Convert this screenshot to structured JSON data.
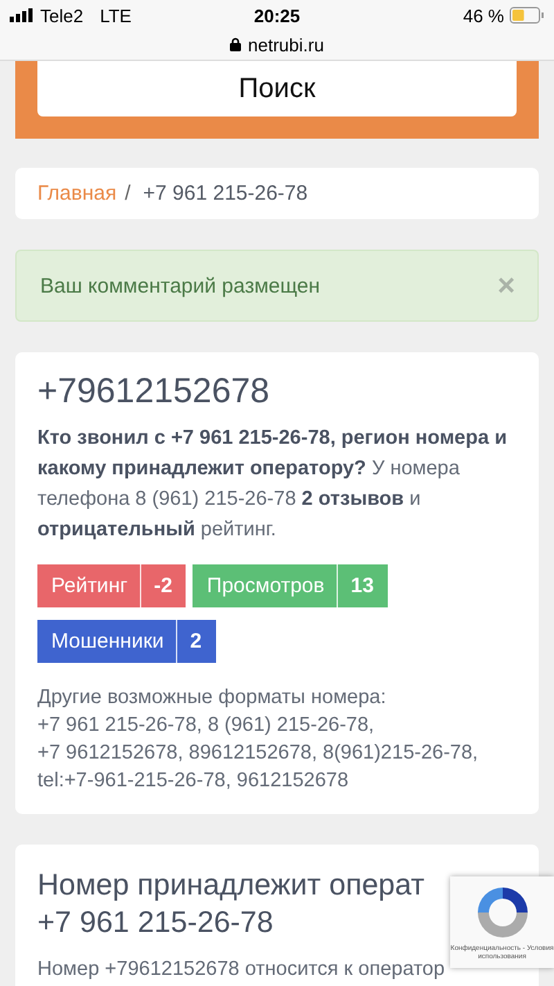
{
  "status_bar": {
    "carrier": "Tele2",
    "network": "LTE",
    "time": "20:25",
    "battery": "46 %"
  },
  "address_bar": {
    "url": "netrubi.ru"
  },
  "search_button": {
    "label": "Поиск"
  },
  "breadcrumb": {
    "separator": "/",
    "items": [
      {
        "label": "Главная",
        "kind": "link"
      },
      {
        "label": "+7 961 215-26-78",
        "kind": "current"
      }
    ]
  },
  "alert": {
    "text": "Ваш комментарий размещен",
    "close": "×"
  },
  "number_card": {
    "title": "+79612152678",
    "description": "**Кто звонил с +7 961 215-26-78, регион номера и какому принадлежит оператору?** У номера телефона 8 (961) 215-26-78 **2 отзывов** и **отрицательный** рейтинг.",
    "badges": [
      {
        "label": "Рейтинг",
        "value": "-2",
        "color": "#e8666a"
      },
      {
        "label": "Просмотров",
        "value": "13",
        "color": "#5cbf76"
      },
      {
        "label": "Мошенники",
        "value": "2",
        "color": "#3f64cf"
      }
    ],
    "formats_title": "Другие возможные форматы номера:",
    "formats": [
      "+7 961 215-26-78, 8 (961) 215-26-78,",
      "+7 9612152678, 89612152678, 8(961)215-26-78,",
      "tel:+7-961-215-26-78, 9612152678"
    ]
  },
  "operator_card": {
    "title_lines": [
      "Номер принадлежит операт",
      "+7 961 215-26-78"
    ],
    "text": "Номер +79612152678 относится к оператор"
  },
  "recaptcha": {
    "caption": "Конфиденциальность - Условия использования"
  }
}
